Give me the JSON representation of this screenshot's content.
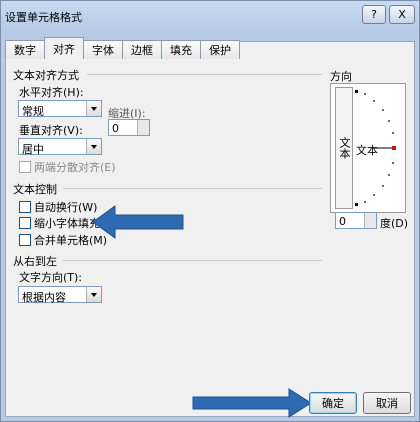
{
  "window": {
    "title": "设置单元格格式",
    "help_label": "?",
    "close_label": "X"
  },
  "tabs": [
    {
      "label": "数字"
    },
    {
      "label": "对齐"
    },
    {
      "label": "字体"
    },
    {
      "label": "边框"
    },
    {
      "label": "填充"
    },
    {
      "label": "保护"
    }
  ],
  "text_align": {
    "section_title": "文本对齐方式",
    "horizontal_label": "水平对齐(H):",
    "horizontal_value": "常规",
    "indent_label": "缩进(I):",
    "indent_value": "0",
    "vertical_label": "垂直对齐(V):",
    "vertical_value": "居中",
    "distributed_label": "两端分散对齐(E)"
  },
  "text_control": {
    "section_title": "文本控制",
    "wrap_label": "自动换行(W)",
    "shrink_label": "缩小字体填充(K)",
    "merge_label": "合并单元格(M)"
  },
  "rtl": {
    "section_title": "从右到左",
    "direction_label": "文字方向(T):",
    "direction_value": "根据内容"
  },
  "orientation": {
    "section_title": "方向",
    "vertical_text": "文本",
    "horizontal_text": "文本",
    "degrees_value": "0",
    "degrees_label": "度(D)"
  },
  "buttons": {
    "ok_label": "确定",
    "cancel_label": "取消"
  },
  "colors": {
    "arrow": "#2f6bb3",
    "marker": "#cc1111"
  }
}
